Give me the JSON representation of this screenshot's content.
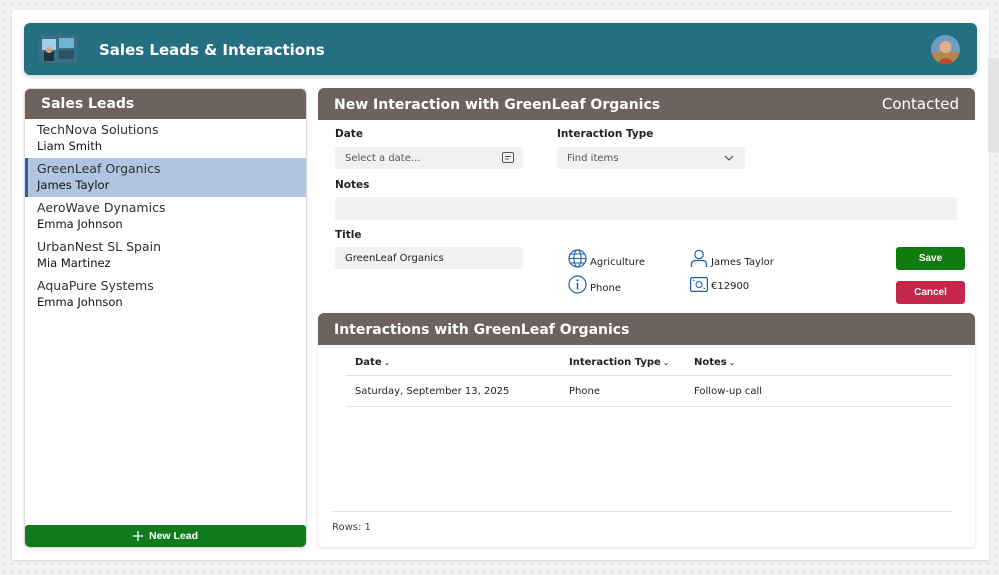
{
  "header": {
    "title": "Sales Leads & Interactions",
    "logo_icon": "analytics-photo-logo",
    "avatar_icon": "user-avatar-photo",
    "background": "#246f82"
  },
  "leads": {
    "title": "Sales Leads",
    "items": [
      {
        "company": "TechNova Solutions",
        "contact": "Liam Smith",
        "selected": false
      },
      {
        "company": "GreenLeaf Organics",
        "contact": "James Taylor",
        "selected": true
      },
      {
        "company": "AeroWave Dynamics",
        "contact": "Emma Johnson",
        "selected": false
      },
      {
        "company": "UrbanNest SL Spain",
        "contact": "Mia Martinez",
        "selected": false
      },
      {
        "company": "AquaPure Systems",
        "contact": "Emma Johnson",
        "selected": false
      }
    ],
    "new_lead_label": "New Lead",
    "new_lead_icon": "plus-icon"
  },
  "form": {
    "title": "New Interaction with GreenLeaf Organics",
    "status": "Contacted",
    "date_label": "Date",
    "date_placeholder": "Select a date...",
    "type_label": "Interaction Type",
    "type_placeholder": "Find items",
    "notes_label": "Notes",
    "notes_value": "",
    "title_label": "Title",
    "title_value": "GreenLeaf Organics",
    "info": {
      "industry": "Agriculture",
      "contact": "James Taylor",
      "channel": "Phone",
      "value": "€12900"
    },
    "save_label": "Save",
    "cancel_label": "Cancel"
  },
  "interactions": {
    "title": "Interactions with GreenLeaf Organics",
    "columns": [
      "Date",
      "Interaction Type",
      "Notes"
    ],
    "rows": [
      {
        "date": "Saturday, September 13, 2025",
        "type": "Phone",
        "notes": "Follow-up call"
      }
    ],
    "footer": "Rows: 1"
  },
  "colors": {
    "panel_header": "#6d625d",
    "selected_row": "#b0c6e0",
    "save": "#107c10",
    "cancel": "#c4264c",
    "new_lead": "#117a1b"
  }
}
